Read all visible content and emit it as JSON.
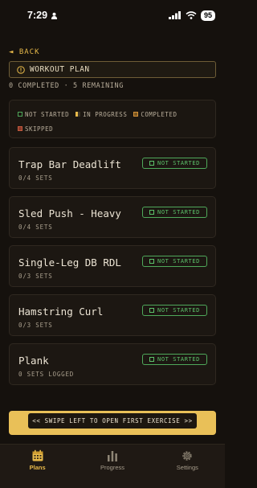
{
  "status_bar": {
    "time": "7:29",
    "battery": "95"
  },
  "nav": {
    "back_label": "◄ BACK"
  },
  "header": {
    "title": "WORKOUT PLAN"
  },
  "summary": "0 COMPLETED · 5 REMAINING",
  "legend": {
    "not_started": "NOT STARTED",
    "in_progress": "IN PROGRESS",
    "completed": "COMPLETED",
    "skipped": "SKIPPED"
  },
  "exercises": [
    {
      "name": "Trap Bar Deadlift",
      "sets": "0/4 SETS",
      "status": "NOT STARTED"
    },
    {
      "name": "Sled Push - Heavy",
      "sets": "0/4 SETS",
      "status": "NOT STARTED"
    },
    {
      "name": "Single-Leg DB RDL",
      "sets": "0/3 SETS",
      "status": "NOT STARTED"
    },
    {
      "name": "Hamstring Curl",
      "sets": "0/3 SETS",
      "status": "NOT STARTED"
    },
    {
      "name": "Plank",
      "sets": "0 SETS LOGGED",
      "status": "NOT STARTED"
    }
  ],
  "swipe_hint": "<< SWIPE LEFT TO OPEN FIRST EXERCISE >>",
  "tabs": [
    {
      "label": "Plans",
      "icon": "calendar-icon",
      "active": true
    },
    {
      "label": "Progress",
      "icon": "bar-chart-icon",
      "active": false
    },
    {
      "label": "Settings",
      "icon": "gear-icon",
      "active": false
    }
  ],
  "colors": {
    "accent": "#e7b94a",
    "status_not_started": "#5cc26a",
    "background": "#15110d"
  }
}
